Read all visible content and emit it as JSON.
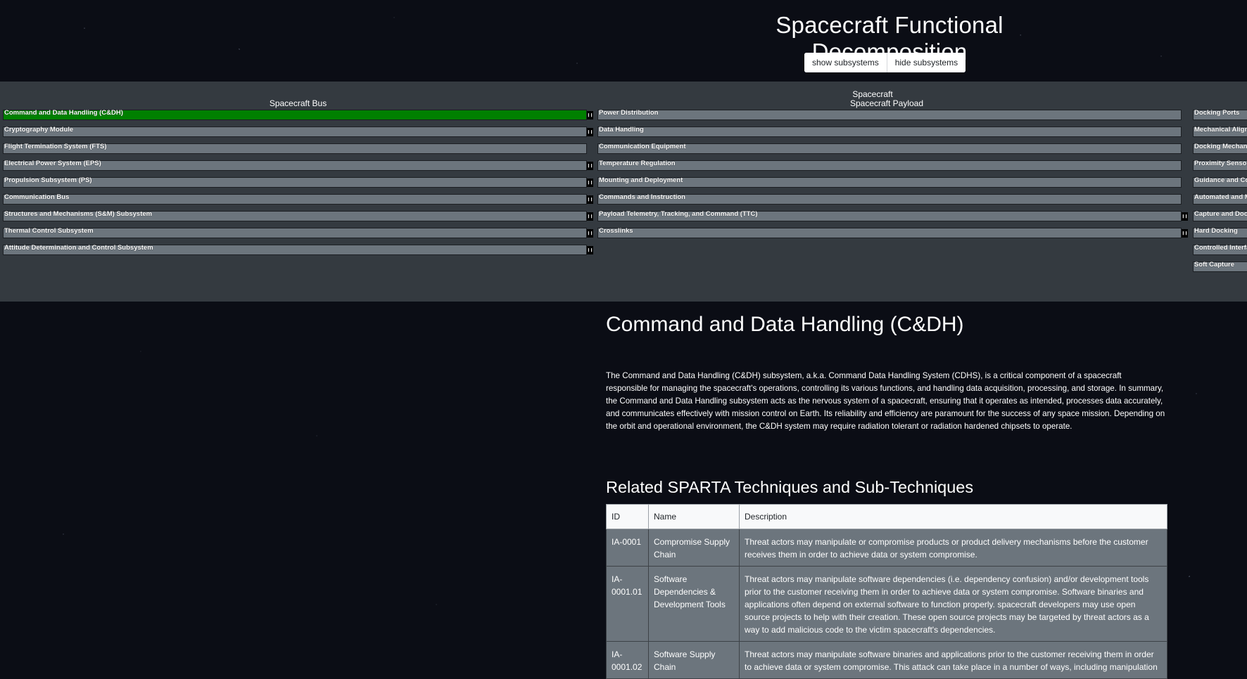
{
  "title": "Spacecraft Functional Decomposition",
  "buttons": {
    "show": "show subsystems",
    "hide": "hide subsystems"
  },
  "columns": [
    {
      "header_top": "",
      "header": "Spacecraft Bus",
      "items": [
        {
          "label": "Command and Data Handling (C&DH)",
          "active": true,
          "handle": true
        },
        {
          "label": "Cryptography Module",
          "handle": true
        },
        {
          "label": "Flight Termination System (FTS)",
          "handle": false
        },
        {
          "label": "Electrical Power System (EPS)",
          "handle": true
        },
        {
          "label": "Propulsion Subsystem (PS)",
          "handle": true
        },
        {
          "label": "Communication Bus",
          "handle": true
        },
        {
          "label": "Structures and Mechanisms (S&M) Subsystem",
          "handle": true
        },
        {
          "label": "Thermal Control Subsystem",
          "handle": true
        },
        {
          "label": "Attitude Determination and Control Subsystem",
          "handle": true
        }
      ]
    },
    {
      "header_top": "Spacecraft",
      "header": "Spacecraft Payload",
      "items": [
        {
          "label": "Power Distribution",
          "handle": false
        },
        {
          "label": "Data Handling",
          "handle": false
        },
        {
          "label": "Communication Equipment",
          "handle": false
        },
        {
          "label": "Temperature Regulation",
          "handle": false
        },
        {
          "label": "Mounting and Deployment",
          "handle": false
        },
        {
          "label": "Commands and Instruction",
          "handle": false
        },
        {
          "label": "Payload Telemetry, Tracking, and Command (TTC)",
          "handle": true
        },
        {
          "label": "Crosslinks",
          "handle": true
        }
      ]
    },
    {
      "header_top": "",
      "header": "",
      "items": [
        {
          "label": "Docking Ports",
          "handle": false
        },
        {
          "label": "Mechanical Align",
          "handle": false
        },
        {
          "label": "Docking Mechani",
          "handle": false
        },
        {
          "label": "Proximity Sensors",
          "handle": false
        },
        {
          "label": "Guidance and Co",
          "handle": false
        },
        {
          "label": "Automated and M",
          "handle": false
        },
        {
          "label": "Capture and Dock",
          "handle": false
        },
        {
          "label": "Hard Docking",
          "handle": false
        },
        {
          "label": "Controlled Interfa",
          "handle": false
        },
        {
          "label": "Soft Capture",
          "handle": false
        }
      ]
    }
  ],
  "detail": {
    "title": "Command and Data Handling (C&DH)",
    "description": "The Command and Data Handling (C&DH) subsystem, a.k.a. Command Data Handling System (CDHS), is a critical component of a spacecraft responsible for managing the spacecraft's operations, controlling its various functions, and handling data acquisition, processing, and storage. In summary, the Command and Data Handling subsystem acts as the nervous system of a spacecraft, ensuring that it operates as intended, processes data accurately, and communicates effectively with mission control on Earth. Its reliability and efficiency are paramount for the success of any space mission. Depending on the orbit and operational environment, the C&DH system may require radiation tolerant or radiation hardened chipsets to operate."
  },
  "related": {
    "title": "Related SPARTA Techniques and Sub-Techniques",
    "columns": [
      "ID",
      "Name",
      "Description"
    ],
    "rows": [
      {
        "id": "IA-0001",
        "name": "Compromise Supply Chain",
        "description": "Threat actors may manipulate or compromise products or product delivery mechanisms before the customer receives them in order to achieve data or system compromise."
      },
      {
        "id": "IA-0001.01",
        "name": "Software Dependencies & Development Tools",
        "description": "Threat actors may manipulate software dependencies (i.e. dependency confusion) and/or development tools prior to the customer receiving them in order to achieve data or system compromise. Software binaries and applications often depend on external software to function properly. spacecraft developers may use open source projects to help with their creation. These open source projects may be targeted by threat actors as a way to add malicious code to the victim spacecraft's dependencies."
      },
      {
        "id": "IA-0001.02",
        "name": "Software Supply Chain",
        "description": "Threat actors may manipulate software binaries and applications prior to the customer receiving them in order to achieve data or system compromise. This attack can take place in a number of ways, including manipulation"
      }
    ]
  },
  "colors": {
    "active": "#008000",
    "item": "#6c757d",
    "panel": "#343a40"
  },
  "icons": {
    "drag_handle": "drag-handle-icon"
  }
}
